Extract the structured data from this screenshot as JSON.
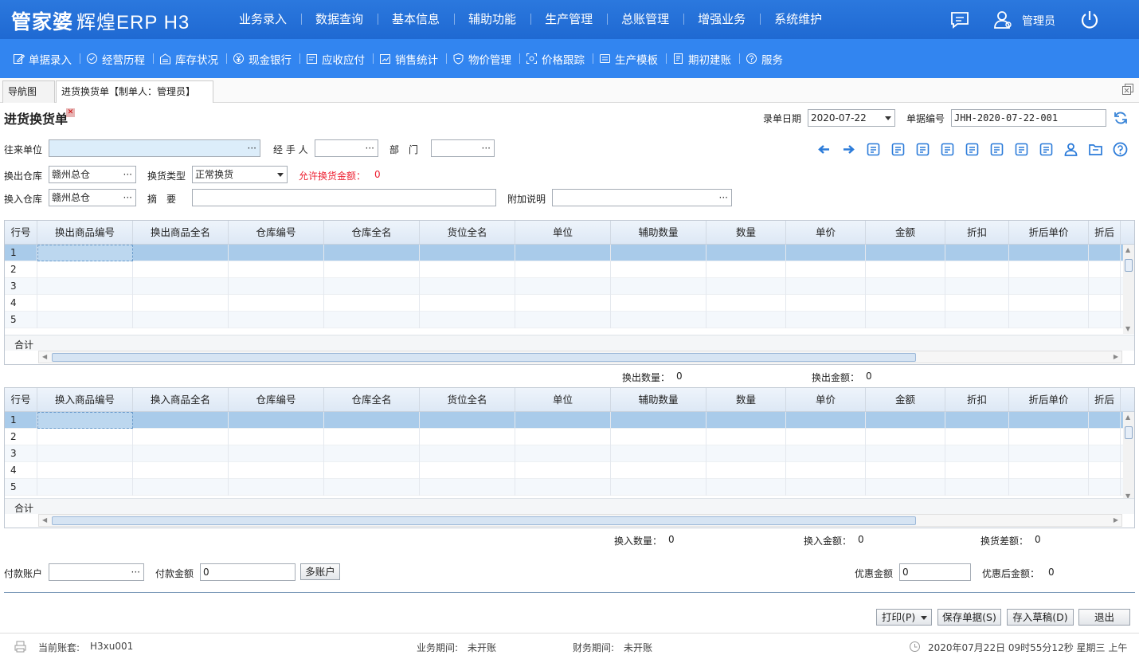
{
  "header": {
    "logo_main": "管家婆",
    "logo_sub": "辉煌ERP H3",
    "nav": [
      "业务录入",
      "数据查询",
      "基本信息",
      "辅助功能",
      "生产管理",
      "总账管理",
      "增强业务",
      "系统维护"
    ],
    "user": "管理员",
    "icons": [
      "message-icon",
      "user-icon",
      "power-icon"
    ]
  },
  "subnav": [
    {
      "label": "单据录入",
      "icon": "edit-icon"
    },
    {
      "label": "经营历程",
      "icon": "check-circle-icon"
    },
    {
      "label": "库存状况",
      "icon": "warehouse-icon"
    },
    {
      "label": "现金银行",
      "icon": "yen-icon"
    },
    {
      "label": "应收应付",
      "icon": "ledger-icon"
    },
    {
      "label": "销售统计",
      "icon": "stats-icon"
    },
    {
      "label": "物价管理",
      "icon": "shield-icon"
    },
    {
      "label": "价格跟踪",
      "icon": "track-icon"
    },
    {
      "label": "生产模板",
      "icon": "template-icon"
    },
    {
      "label": "期初建账",
      "icon": "book-icon"
    },
    {
      "label": "服务",
      "icon": "help-icon"
    }
  ],
  "tabs": {
    "nav": "导航图",
    "active": "进货换货单【制单人：管理员】"
  },
  "form": {
    "title": "进货换货单",
    "date_label": "录单日期",
    "date_value": "2020-07-22",
    "no_label": "单据编号",
    "no_value": "JHH-2020-07-22-001",
    "partner_label": "往来单位",
    "partner_value": "",
    "handler_label": "经 手 人",
    "handler_value": "",
    "dept_label": "部　门",
    "dept_value": "",
    "out_wh_label": "换出仓库",
    "out_wh_value": "赣州总仓",
    "type_label": "换货类型",
    "type_value": "正常换货",
    "allow_label": "允许换货金额：",
    "allow_value": "0",
    "in_wh_label": "换入仓库",
    "in_wh_value": "赣州总仓",
    "summary_label": "摘　要",
    "summary_value": "",
    "extra_label": "附加说明",
    "extra_value": ""
  },
  "toolbar_icons": [
    "prev-arrow-icon",
    "next-arrow-icon",
    "barcode-icon",
    "print-setup-icon",
    "settings-icon",
    "copy-icon",
    "import-icon",
    "number-icon",
    "save-icon",
    "export-icon",
    "person-icon",
    "folder-icon",
    "help-icon"
  ],
  "grid_out": {
    "columns": [
      "行号",
      "换出商品编号",
      "换出商品全名",
      "仓库编号",
      "仓库全名",
      "货位全名",
      "单位",
      "辅助数量",
      "数量",
      "单价",
      "金额",
      "折扣",
      "折后单价",
      "折后"
    ],
    "rows": [
      "1",
      "2",
      "3",
      "4",
      "5"
    ],
    "total_label": "合计",
    "sum_qty_label": "换出数量：",
    "sum_qty": "0",
    "sum_amt_label": "换出金额：",
    "sum_amt": "0"
  },
  "grid_in": {
    "columns": [
      "行号",
      "换入商品编号",
      "换入商品全名",
      "仓库编号",
      "仓库全名",
      "货位全名",
      "单位",
      "辅助数量",
      "数量",
      "单价",
      "金额",
      "折扣",
      "折后单价",
      "折后"
    ],
    "rows": [
      "1",
      "2",
      "3",
      "4",
      "5"
    ],
    "total_label": "合计",
    "sum_qty_label": "换入数量：",
    "sum_qty": "0",
    "sum_amt_label": "换入金额：",
    "sum_amt": "0",
    "diff_label": "换货差额：",
    "diff": "0"
  },
  "payment": {
    "account_label": "付款账户",
    "account_value": "",
    "amount_label": "付款金额",
    "amount_value": "0",
    "multi_btn": "多账户",
    "discount_label": "优惠金额",
    "discount_value": "0",
    "after_label": "优惠后金额：",
    "after_value": "0"
  },
  "actions": {
    "print": "打印(P)",
    "save": "保存单据(S)",
    "draft": "存入草稿(D)",
    "exit": "退出"
  },
  "status": {
    "account_label": "当前账套:",
    "account": "H3xu001",
    "biz_label": "业务期间:",
    "biz": "未开账",
    "fin_label": "财务期间:",
    "fin": "未开账",
    "datetime": "2020年07月22日 09时55分12秒 星期三 上午"
  }
}
